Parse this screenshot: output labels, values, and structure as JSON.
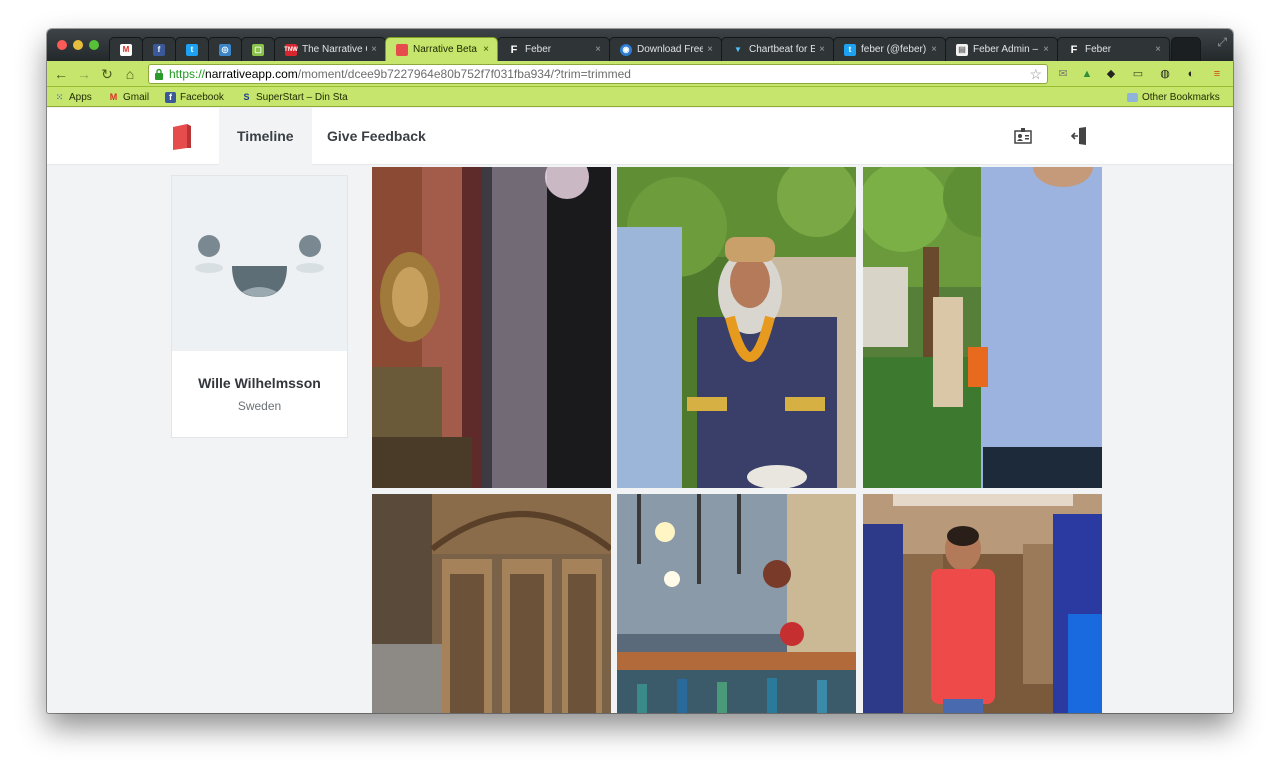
{
  "browser": {
    "tabs": [
      {
        "title": "",
        "icon": "gmail-icon",
        "pinned": true
      },
      {
        "title": "",
        "icon": "facebook-icon",
        "pinned": true
      },
      {
        "title": "",
        "icon": "twitter-icon",
        "pinned": true
      },
      {
        "title": "",
        "icon": "feed-icon",
        "pinned": true
      },
      {
        "title": "",
        "icon": "app-icon",
        "pinned": true
      },
      {
        "title": "The Narrative C",
        "icon": "tnw-icon"
      },
      {
        "title": "Narrative Beta",
        "icon": "narrative-icon",
        "active": true
      },
      {
        "title": "Feber",
        "icon": "feber-icon"
      },
      {
        "title": "Download Free",
        "icon": "download-icon"
      },
      {
        "title": "Chartbeat for E",
        "icon": "chartbeat-icon"
      },
      {
        "title": "feber (@feber)",
        "icon": "twitter-icon"
      },
      {
        "title": "Feber Admin –",
        "icon": "document-icon"
      },
      {
        "title": "Feber",
        "icon": "feber-icon"
      }
    ],
    "close_glyph": "×",
    "url": {
      "scheme": "https://",
      "host": "narrativeapp.com",
      "path": "/moment/dcee9b7227964e80b752f7f031fba934/?trim=trimmed"
    },
    "bookmarks": [
      {
        "label": "Apps",
        "icon": "apps-grid-icon"
      },
      {
        "label": "Gmail",
        "icon": "gmail-icon"
      },
      {
        "label": "Facebook",
        "icon": "facebook-icon"
      },
      {
        "label": "SuperStart – Din Sta",
        "icon": "superstart-icon"
      }
    ],
    "other_bookmarks": "Other Bookmarks",
    "theme_color": "#c6e56c"
  },
  "app": {
    "nav": {
      "timeline": "Timeline",
      "feedback": "Give Feedback"
    },
    "brand_color": "#e64c4c",
    "profile": {
      "name": "Wille Wilhelmsson",
      "country": "Sweden"
    },
    "photos": [
      {
        "subject": "bazaar-fabrics"
      },
      {
        "subject": "man-with-amber-necklace"
      },
      {
        "subject": "trees-and-blue-shirt"
      },
      {
        "subject": "carved-wooden-door"
      },
      {
        "subject": "glass-shop-display"
      },
      {
        "subject": "man-in-red-shirt-at-market"
      }
    ]
  }
}
